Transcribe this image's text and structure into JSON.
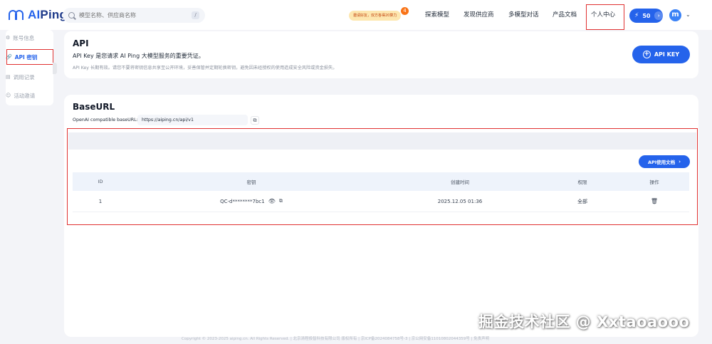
{
  "header": {
    "logo_text_a": "AI",
    "logo_text_b": "Ping",
    "search_placeholder": "模型名称、供应商名称",
    "search_shortcut": "/",
    "promo_text": "邀请好友，双方各得20算力",
    "promo_badge": "4",
    "nav": [
      "探索模型",
      "发现供应商",
      "多模型对话",
      "产品文档",
      "个人中心"
    ],
    "credits": "50",
    "avatar_letter": "m"
  },
  "sidebar": {
    "items": [
      {
        "icon": "⚙",
        "label": "账号信息"
      },
      {
        "icon": "🔗",
        "label": "API 密钥"
      },
      {
        "icon": "▤",
        "label": "调用记录"
      },
      {
        "icon": "☺",
        "label": "活动邀请"
      }
    ],
    "active_index": 1
  },
  "api_card": {
    "title": "API",
    "subtitle": "API Key 是您请求 AI Ping 大模型服务的重要凭证。",
    "note": "API Key 长期有效。请您不要将密钥信息共享至公开环境，妥善保管并定期轮换密钥，避免因未经授权的使用造成安全风险或资金损失。",
    "button_label": "API KEY"
  },
  "base_card": {
    "title": "BaseURL",
    "label": "OpenAI compatible baseURL:",
    "url": "https://aiping.cn/api/v1",
    "docs_button": "API使用文档"
  },
  "table": {
    "headers": [
      "ID",
      "密钥",
      "创建时间",
      "权限",
      "操作"
    ],
    "rows": [
      {
        "id": "1",
        "key": "QC-d********7bc1",
        "created": "2025.12.05 01:36",
        "permission": "全部"
      }
    ]
  },
  "footer": "Copyright © 2023-2025 aiping.cn. All Rights Reserved.   |   北京清程极智科技有限公司 版权所有   |   京ICP备2024084758号-3   |   京公网安备11010802044359号   |   免责声明",
  "watermark": "掘金技术社区 @ Xxtaoaooo",
  "colors": {
    "accent": "#2563eb",
    "highlight_box": "#e03131",
    "page_bg": "#f3f4f8"
  }
}
